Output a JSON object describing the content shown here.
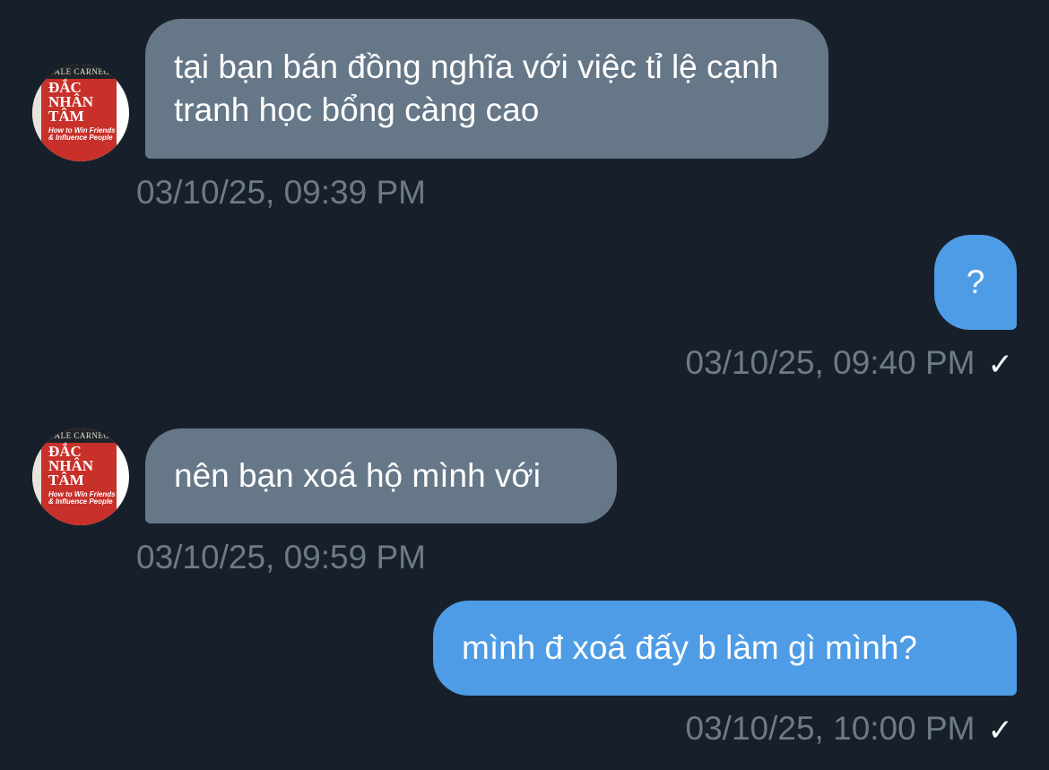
{
  "messages": [
    {
      "direction": "incoming",
      "text": "tại bạn bán đồng nghĩa với việc tỉ lệ cạnh tranh học bổng càng cao",
      "timestamp": "03/10/25, 09:39 PM",
      "avatar": {
        "book_top": "DALE CARNEG",
        "book_title": "ĐẮC NHÂN TÂM",
        "book_sub": "How to Win Friends & Influence People"
      }
    },
    {
      "direction": "outgoing",
      "text": "?",
      "timestamp": "03/10/25, 09:40 PM",
      "status_icon": "check-icon"
    },
    {
      "direction": "incoming",
      "text": "nên bạn xoá hộ mình với",
      "timestamp": "03/10/25, 09:59 PM",
      "avatar": {
        "book_top": "DALE CARNEG",
        "book_title": "ĐẮC NHÂN TÂM",
        "book_sub": "How to Win Friends & Influence People"
      }
    },
    {
      "direction": "outgoing",
      "text": "mình đ xoá đấy b làm gì mình?",
      "timestamp": "03/10/25, 10:00 PM",
      "status_icon": "check-icon"
    }
  ],
  "colors": {
    "background": "#17202a",
    "incoming_bubble": "#667788",
    "outgoing_bubble": "#4e9ce6",
    "timestamp": "#6e7a88"
  }
}
